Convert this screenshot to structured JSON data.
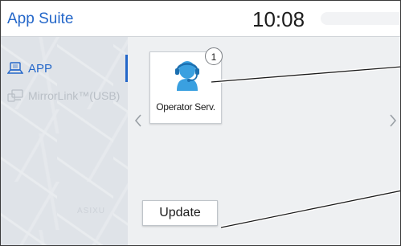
{
  "header": {
    "title": "App Suite",
    "clock": "10:08"
  },
  "sidebar": {
    "items": [
      {
        "label": "APP",
        "icon": "app-icon",
        "active": true
      },
      {
        "label": "MirrorLink™(USB)",
        "icon": "mirrorlink-icon",
        "active": false
      }
    ],
    "background_text": "ASIXU"
  },
  "main": {
    "apps": [
      {
        "label": "Operator Serv.",
        "icon": "operator-headset-icon"
      }
    ],
    "update_label": "Update",
    "prev_icon": "chevron-left-icon",
    "next_icon": "chevron-right-icon"
  },
  "callouts": [
    {
      "number": "1",
      "target": "operator-service-tile"
    }
  ],
  "colors": {
    "accent": "#2467c9",
    "inactive_text": "#b9bfc6",
    "tile_bg": "#ffffff",
    "icon_blue": "#3aa0e0"
  }
}
